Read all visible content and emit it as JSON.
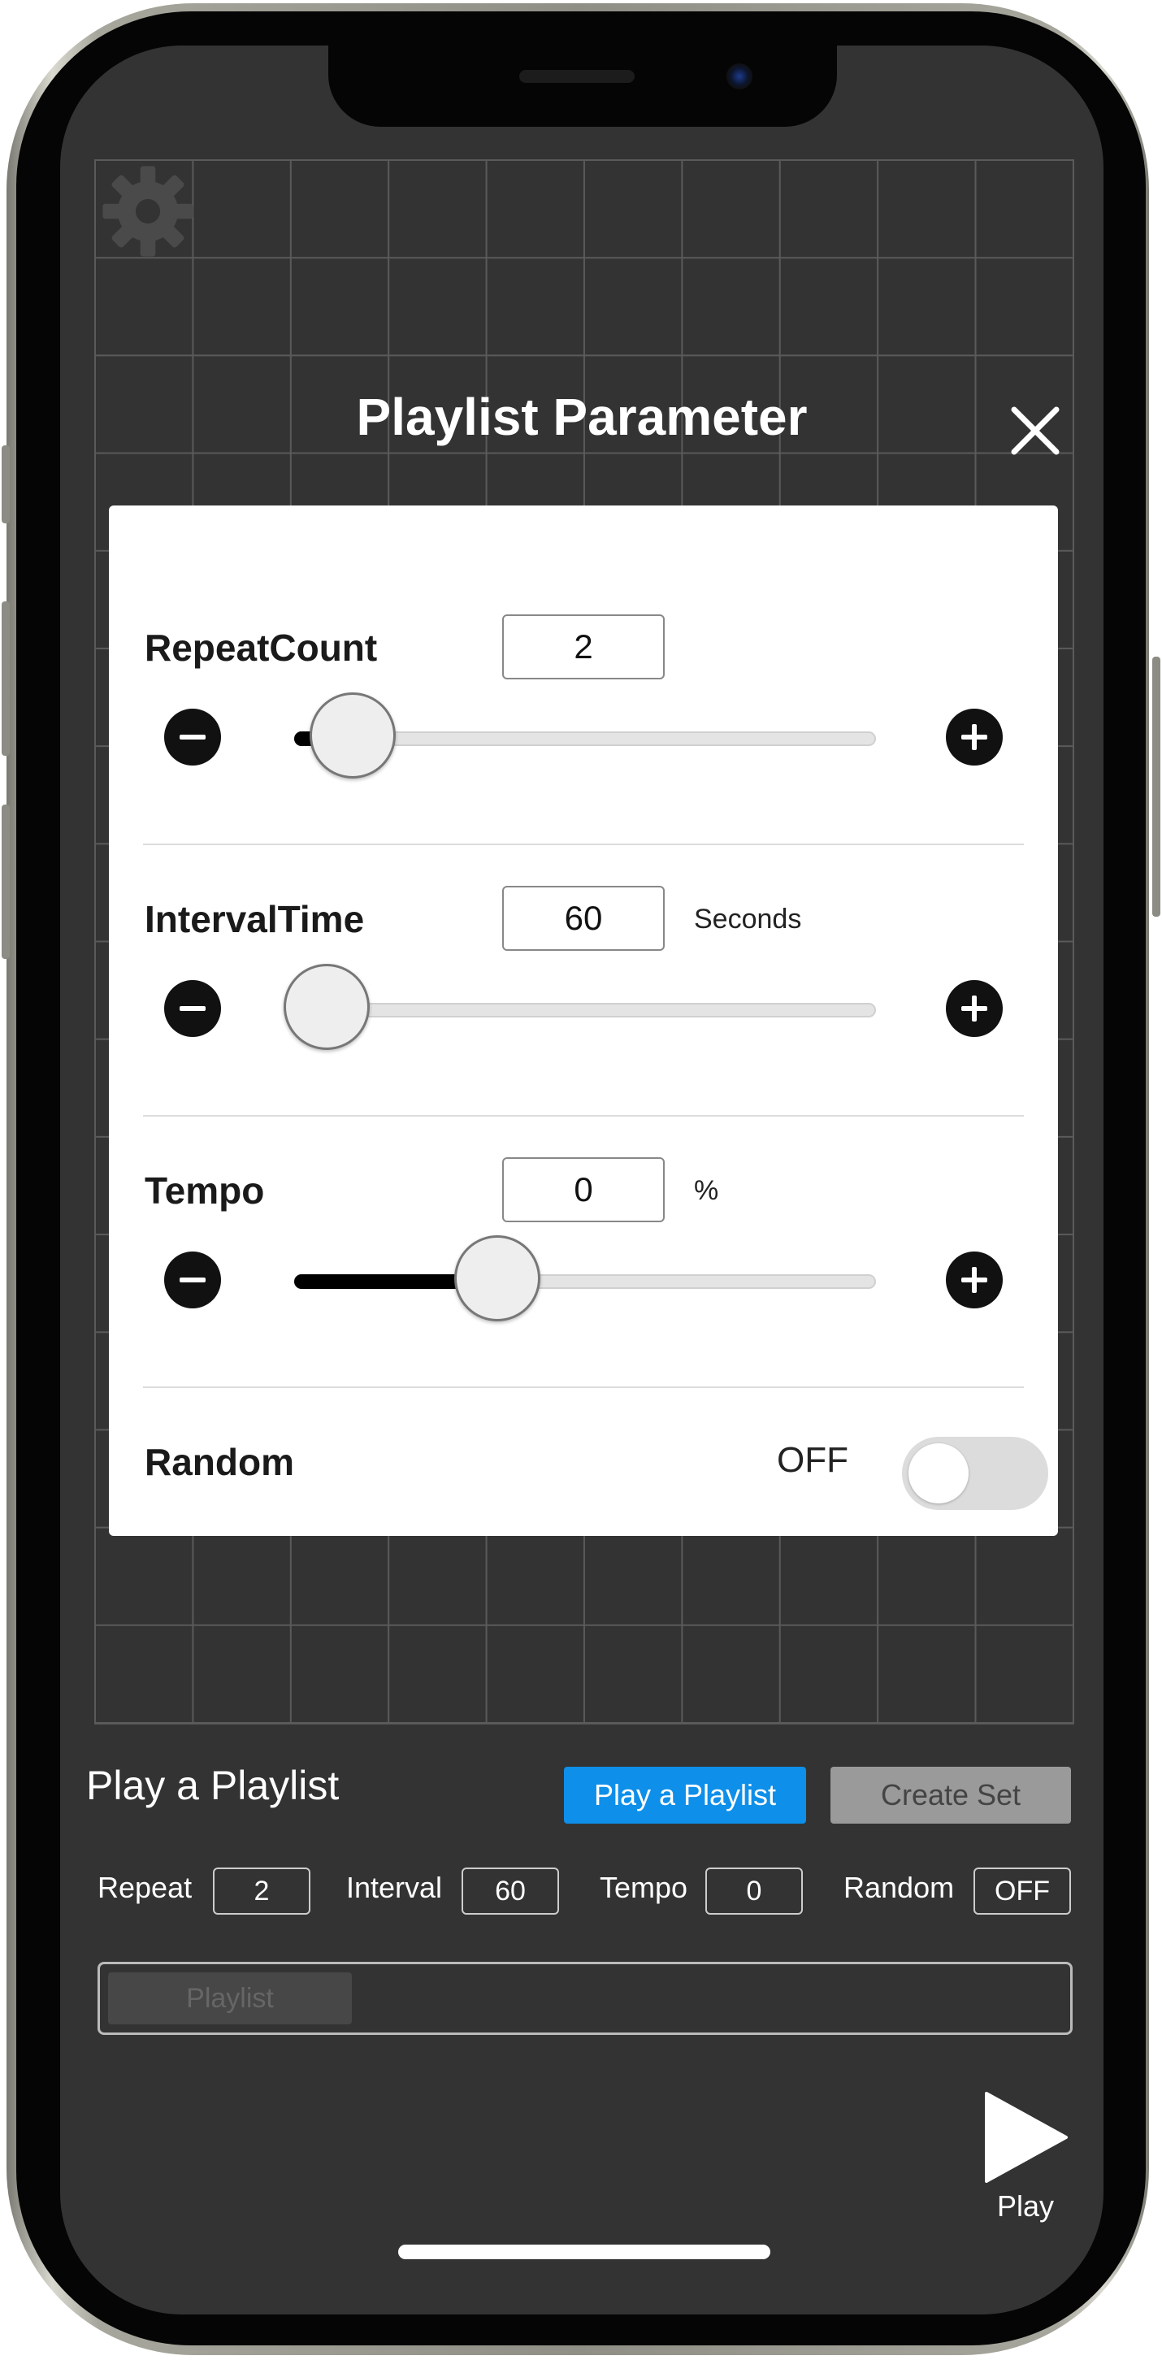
{
  "modal": {
    "title": "Playlist Parameter",
    "close_icon": "close-icon",
    "repeat": {
      "label": "RepeatCount",
      "value": "2",
      "slider_fraction": 0.05
    },
    "interval": {
      "label": "IntervalTime",
      "value": "60",
      "unit": "Seconds",
      "slider_fraction": 0.0
    },
    "tempo": {
      "label": "Tempo",
      "value": "0",
      "unit": "%",
      "slider_fraction": 0.33
    },
    "random": {
      "label": "Random",
      "state_text": "OFF",
      "on": false
    }
  },
  "bottom": {
    "title": "Play a Playlist",
    "play_playlist_button": "Play a Playlist",
    "create_set_button": "Create Set",
    "summary": {
      "repeat_label": "Repeat",
      "repeat_value": "2",
      "interval_label": "Interval",
      "interval_value": "60",
      "tempo_label": "Tempo",
      "tempo_value": "0",
      "random_label": "Random",
      "random_value": "OFF"
    },
    "playlist_chip": "Playlist",
    "play_label": "Play"
  },
  "colors": {
    "background": "#333333",
    "accent_blue": "#0e8fe9",
    "card": "#ffffff"
  },
  "icons": {
    "settings": "gear-icon",
    "minus": "minus-circle-icon",
    "plus": "plus-circle-icon",
    "play": "play-icon"
  }
}
